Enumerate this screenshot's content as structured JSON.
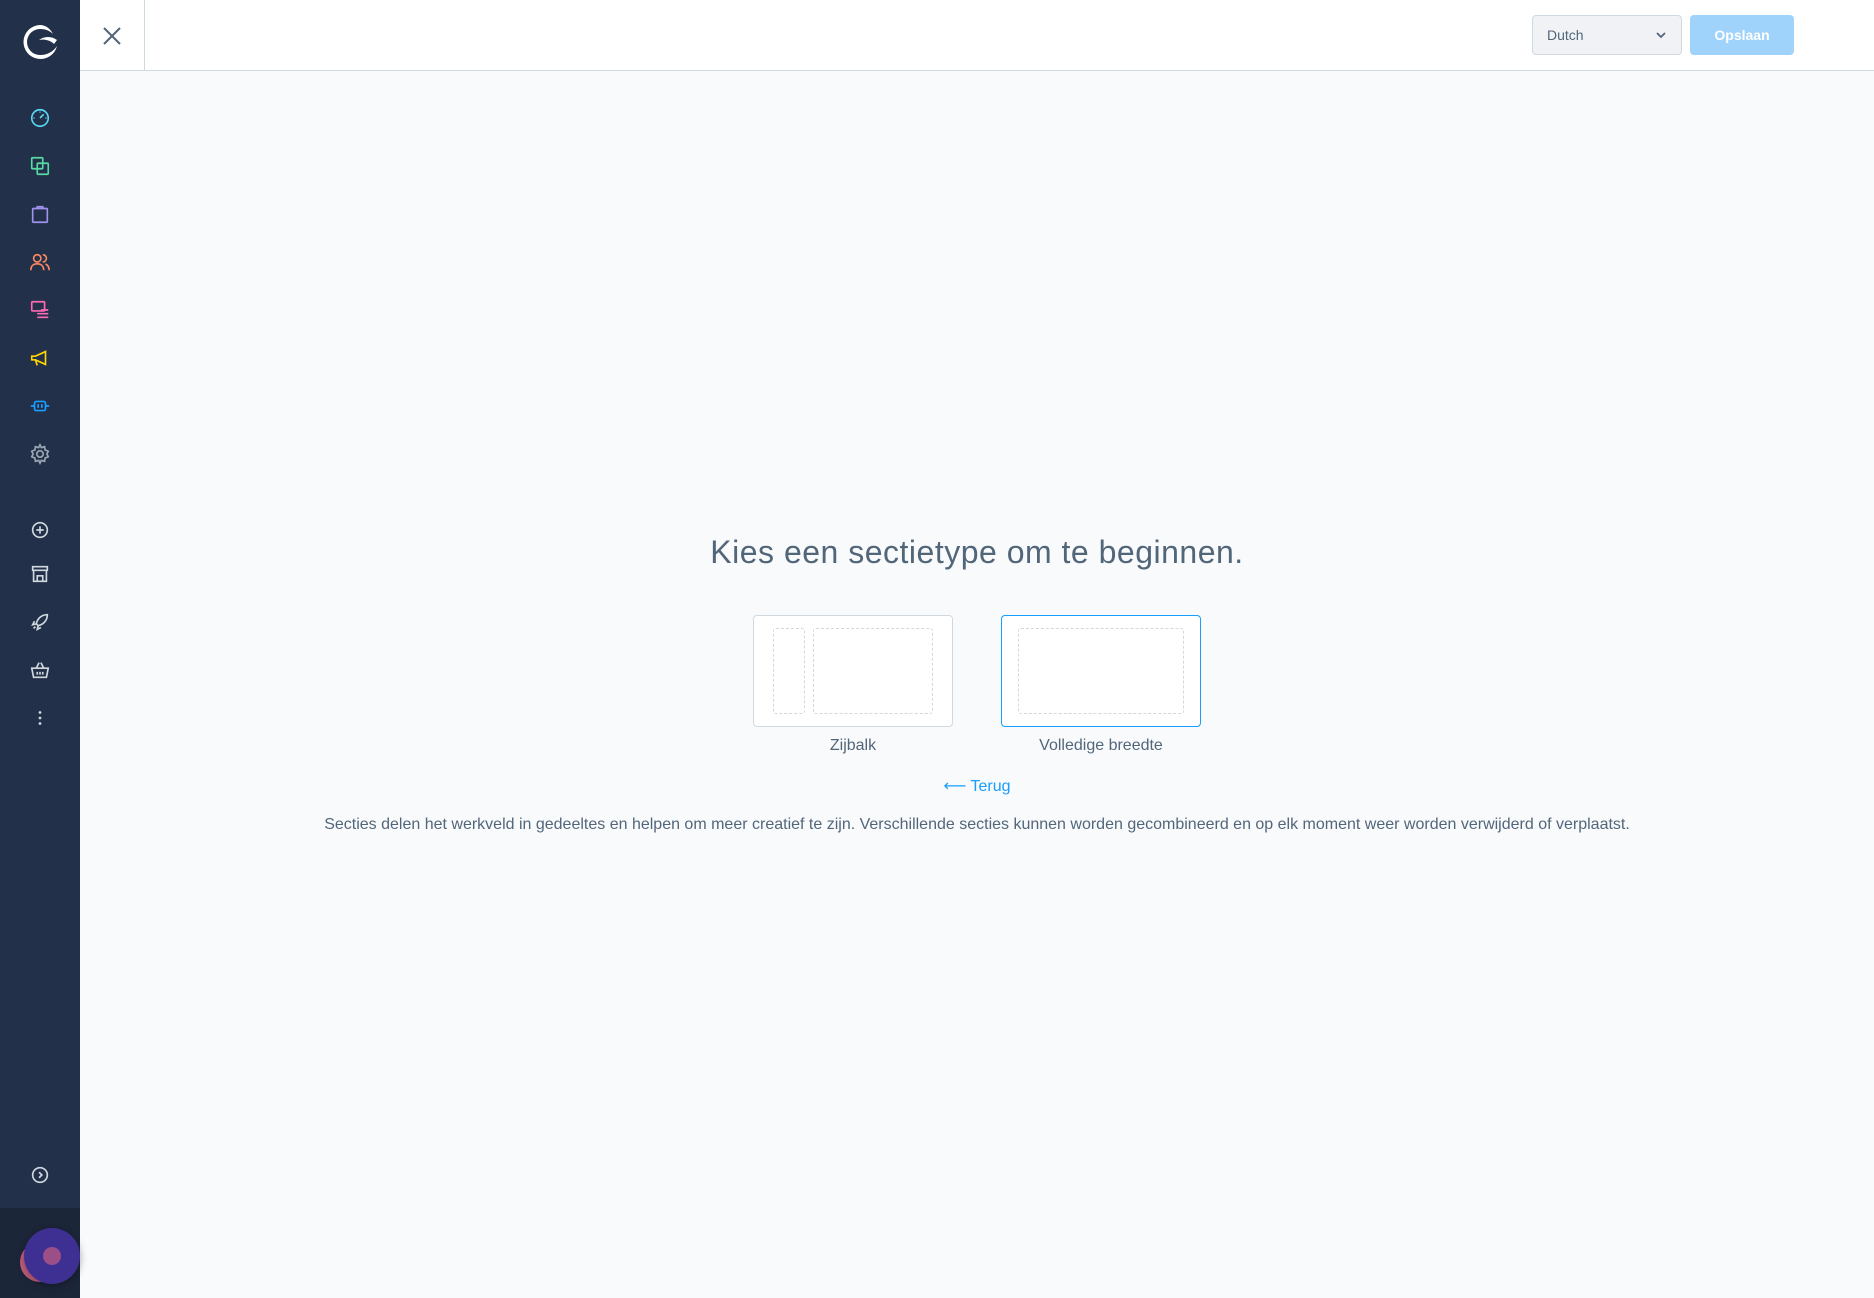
{
  "sidebar": {
    "nav": [
      {
        "name": "dashboard",
        "icon": "dashboard-gauge-icon",
        "color": "#57d9f5"
      },
      {
        "name": "catalogues",
        "icon": "products-copy-icon",
        "color": "#57d9a3"
      },
      {
        "name": "orders",
        "icon": "shopping-bag-icon",
        "color": "#a092f0"
      },
      {
        "name": "customers",
        "icon": "users-icon",
        "color": "#f88962"
      },
      {
        "name": "content",
        "icon": "content-list-icon",
        "color": "#ff68b4"
      },
      {
        "name": "marketing",
        "icon": "megaphone-icon",
        "color": "#ffd700"
      },
      {
        "name": "extensions",
        "icon": "plug-icon",
        "color": "#189eff"
      },
      {
        "name": "settings",
        "icon": "gear-icon",
        "color": "#9aa8b5"
      }
    ],
    "secondary": [
      {
        "name": "add",
        "icon": "plus-circle-icon"
      },
      {
        "name": "store",
        "icon": "storefront-icon"
      },
      {
        "name": "launch",
        "icon": "rocket-icon"
      },
      {
        "name": "basket",
        "icon": "basket-icon"
      },
      {
        "name": "more",
        "icon": "more-vertical-icon"
      }
    ],
    "collapse_icon": "chevron-right-circle-icon"
  },
  "topbar": {
    "close_icon": "close-icon",
    "language": "Dutch",
    "save_label": "Opslaan"
  },
  "main": {
    "headline": "Kies een sectietype om te beginnen.",
    "options": [
      {
        "label": "Zijbalk",
        "selected": false
      },
      {
        "label": "Volledige breedte",
        "selected": true
      }
    ],
    "back_arrow": "⟵",
    "back_label": "Terug",
    "hint": "Secties delen het werkveld in gedeeltes en helpen om meer creatief te zijn. Verschillende secties kunnen worden gecombineerd en op elk moment weer worden verwijderd of verplaatst."
  },
  "colors": {
    "sidebar_bg": "#233049",
    "accent": "#189eff",
    "save_disabled": "#9fd3fb"
  }
}
